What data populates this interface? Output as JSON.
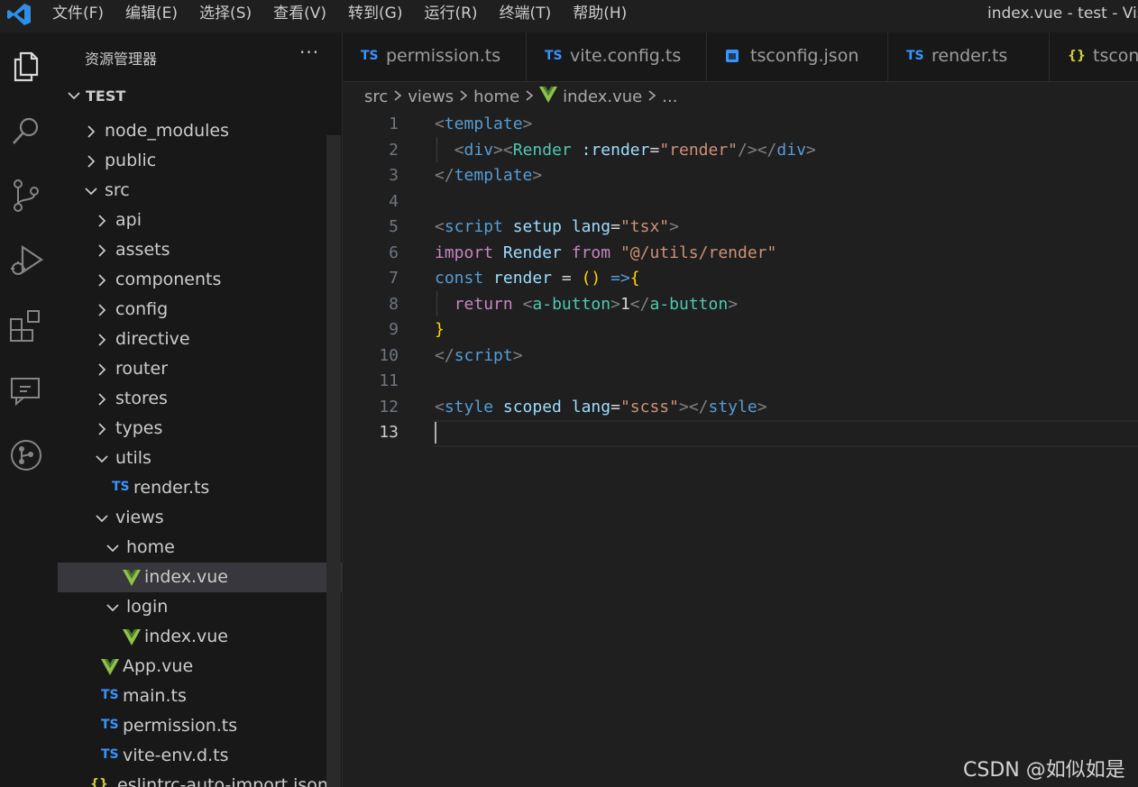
{
  "menu": [
    "文件(F)",
    "编辑(E)",
    "选择(S)",
    "查看(V)",
    "转到(G)",
    "运行(R)",
    "终端(T)",
    "帮助(H)"
  ],
  "window_title": "index.vue - test - Visu",
  "sidebar": {
    "title": "资源管理器",
    "more": "···",
    "root": "TEST",
    "items": [
      {
        "label": "node_modules",
        "type": "folder",
        "expanded": false
      },
      {
        "label": "public",
        "type": "folder",
        "expanded": false
      },
      {
        "label": "src",
        "type": "folder",
        "expanded": true
      },
      {
        "label": "api",
        "type": "folder",
        "expanded": false
      },
      {
        "label": "assets",
        "type": "folder",
        "expanded": false
      },
      {
        "label": "components",
        "type": "folder",
        "expanded": false
      },
      {
        "label": "config",
        "type": "folder",
        "expanded": false
      },
      {
        "label": "directive",
        "type": "folder",
        "expanded": false
      },
      {
        "label": "router",
        "type": "folder",
        "expanded": false
      },
      {
        "label": "stores",
        "type": "folder",
        "expanded": false
      },
      {
        "label": "types",
        "type": "folder",
        "expanded": false
      },
      {
        "label": "utils",
        "type": "folder",
        "expanded": true
      },
      {
        "label": "render.ts",
        "type": "ts"
      },
      {
        "label": "views",
        "type": "folder",
        "expanded": true
      },
      {
        "label": "home",
        "type": "folder",
        "expanded": true
      },
      {
        "label": "index.vue",
        "type": "vue",
        "selected": true
      },
      {
        "label": "login",
        "type": "folder",
        "expanded": true
      },
      {
        "label": "index.vue",
        "type": "vue"
      },
      {
        "label": "App.vue",
        "type": "vue"
      },
      {
        "label": "main.ts",
        "type": "ts"
      },
      {
        "label": "permission.ts",
        "type": "ts"
      },
      {
        "label": "vite-env.d.ts",
        "type": "ts"
      },
      {
        "label": ".eslintrc-auto-import.json",
        "type": "json"
      }
    ],
    "ts_icon": "TS",
    "json_icon": "{}"
  },
  "tabs": [
    {
      "label": "permission.ts",
      "icon": "TS"
    },
    {
      "label": "vite.config.ts",
      "icon": "TS"
    },
    {
      "label": "tsconfig.json",
      "icon": "tsconfig"
    },
    {
      "label": "render.ts",
      "icon": "TS"
    },
    {
      "label": "tsconf",
      "icon": "{}"
    }
  ],
  "breadcrumb": [
    "src",
    "views",
    "home",
    "index.vue",
    "..."
  ],
  "editor": {
    "active_line": 13,
    "lines": [
      {
        "n": "1",
        "tokens": [
          [
            "<",
            "br"
          ],
          [
            "template",
            "tag"
          ],
          [
            ">",
            "br"
          ]
        ]
      },
      {
        "n": "2",
        "tokens": [
          [
            "  ",
            "plain"
          ],
          [
            "<",
            "br"
          ],
          [
            "div",
            "tag"
          ],
          [
            ">",
            "br"
          ],
          [
            "<",
            "br"
          ],
          [
            "Render",
            "comp"
          ],
          [
            " ",
            "plain"
          ],
          [
            ":render",
            "attr"
          ],
          [
            "=",
            "plain"
          ],
          [
            "\"render\"",
            "str"
          ],
          [
            "/>",
            "br"
          ],
          [
            "</",
            "br"
          ],
          [
            "div",
            "tag"
          ],
          [
            ">",
            "br"
          ]
        ]
      },
      {
        "n": "3",
        "tokens": [
          [
            "</",
            "br"
          ],
          [
            "template",
            "tag"
          ],
          [
            ">",
            "br"
          ]
        ]
      },
      {
        "n": "4",
        "tokens": []
      },
      {
        "n": "5",
        "tokens": [
          [
            "<",
            "br"
          ],
          [
            "script",
            "tag"
          ],
          [
            " ",
            "plain"
          ],
          [
            "setup",
            "attr"
          ],
          [
            " ",
            "plain"
          ],
          [
            "lang",
            "attr"
          ],
          [
            "=",
            "plain"
          ],
          [
            "\"tsx\"",
            "str"
          ],
          [
            ">",
            "br"
          ]
        ]
      },
      {
        "n": "6",
        "tokens": [
          [
            "import",
            "kw"
          ],
          [
            " ",
            "plain"
          ],
          [
            "Render",
            "var"
          ],
          [
            " ",
            "plain"
          ],
          [
            "from",
            "kw"
          ],
          [
            " ",
            "plain"
          ],
          [
            "\"@/utils/render\"",
            "str"
          ]
        ]
      },
      {
        "n": "7",
        "tokens": [
          [
            "const",
            "const"
          ],
          [
            " ",
            "plain"
          ],
          [
            "render",
            "var"
          ],
          [
            " = ",
            "plain"
          ],
          [
            "()",
            "brace"
          ],
          [
            " ",
            "plain"
          ],
          [
            "=>",
            "const"
          ],
          [
            "{",
            "brace"
          ]
        ]
      },
      {
        "n": "8",
        "tokens": [
          [
            "  ",
            "plain"
          ],
          [
            "return",
            "kw"
          ],
          [
            " ",
            "plain"
          ],
          [
            "<",
            "br"
          ],
          [
            "a-button",
            "comp"
          ],
          [
            ">",
            "br"
          ],
          [
            "1",
            "plain"
          ],
          [
            "</",
            "br"
          ],
          [
            "a-button",
            "comp"
          ],
          [
            ">",
            "br"
          ]
        ]
      },
      {
        "n": "9",
        "tokens": [
          [
            "}",
            "brace"
          ]
        ]
      },
      {
        "n": "10",
        "tokens": [
          [
            "</",
            "br"
          ],
          [
            "script",
            "tag"
          ],
          [
            ">",
            "br"
          ]
        ]
      },
      {
        "n": "11",
        "tokens": []
      },
      {
        "n": "12",
        "tokens": [
          [
            "<",
            "br"
          ],
          [
            "style",
            "tag"
          ],
          [
            " ",
            "plain"
          ],
          [
            "scoped",
            "attr"
          ],
          [
            " ",
            "plain"
          ],
          [
            "lang",
            "attr"
          ],
          [
            "=",
            "plain"
          ],
          [
            "\"scss\"",
            "str"
          ],
          [
            "></",
            "br"
          ],
          [
            "style",
            "tag"
          ],
          [
            ">",
            "br"
          ]
        ]
      },
      {
        "n": "13",
        "tokens": []
      }
    ]
  },
  "watermark": "CSDN @如似如是",
  "colors": {
    "ts": "#3794ff",
    "vue": "#8dc149",
    "json": "#cbcb41",
    "vscode_blue": "#2f8ee6"
  },
  "activity_icons": [
    "explorer-icon",
    "search-icon",
    "source-control-icon",
    "run-debug-icon",
    "extensions-icon",
    "remote-explorer-icon",
    "git-graph-icon"
  ]
}
